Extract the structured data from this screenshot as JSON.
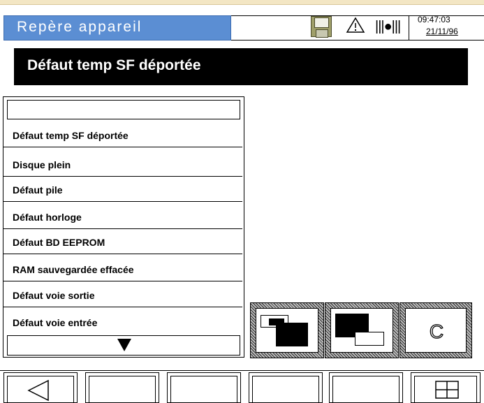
{
  "status": {
    "title": "Repère appareil",
    "time": "09:47:03",
    "date": "21/11/96",
    "record_indicator": "|||●|||",
    "icons": [
      "floppy-disk-icon",
      "warning-icon",
      "record-icon"
    ]
  },
  "header": {
    "title": "Défaut temp SF déportée"
  },
  "list": {
    "input_value": "",
    "items": [
      "Défaut temp SF déportée",
      "Disque plein",
      "Défaut pile",
      "Défaut horloge",
      "Défaut BD EEPROM",
      "RAM sauvegardée effacée",
      "Défaut voie sortie",
      "Défaut voie entrée"
    ],
    "scroll_icon": "scroll-down-icon"
  },
  "actions": {
    "clear_label": "C",
    "icons": [
      "window-back-icon",
      "window-front-icon",
      "clear-icon"
    ]
  },
  "footer": {
    "icons": [
      "back-triangle-icon",
      "grid-icon"
    ]
  },
  "colors": {
    "title_bar": "#5b8ed3",
    "header_bg": "#000000"
  }
}
